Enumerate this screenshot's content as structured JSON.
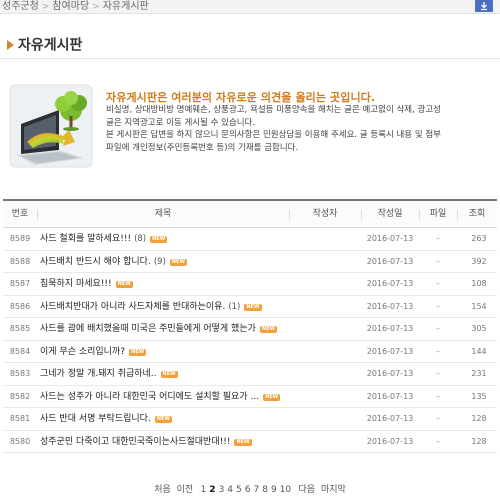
{
  "breadcrumb": {
    "items": [
      "성주군청",
      "참여마당",
      "자유게시판"
    ]
  },
  "page": {
    "title": "자유게시판"
  },
  "intro": {
    "heading": "자유게시판은 여러분의 자유로운 의견을 올리는 곳입니다.",
    "lines": [
      "비실명, 상대방비방 명예훼손, 상품광고, 욕설등 미풍양속을 해치는 글은 예고없이 삭제, 광고성",
      "글은 지역광고로 이동 게시될 수 있습니다.",
      "본 게시판은 답변을 하지 않으니 문의사항은 민원상담을 이용해 주세요. 글 등록시 내용 및 첨부",
      "파일에 개인정보(주민등록번호 등)의 기재를 금합니다."
    ]
  },
  "board": {
    "columns": {
      "num": "번호",
      "title": "제목",
      "author": "작성자",
      "date": "작성일",
      "file": "파일",
      "hits": "조회"
    },
    "new_label": "NEW",
    "rows": [
      {
        "num": "8589",
        "title": "사드 철회를 말하세요!!!",
        "comments": "(8)",
        "author": "",
        "date": "2016-07-13",
        "file": "–",
        "hits": "263"
      },
      {
        "num": "8588",
        "title": "사드배치 반드시 해야 합니다.",
        "comments": "(9)",
        "author": "",
        "date": "2016-07-13",
        "file": "–",
        "hits": "392"
      },
      {
        "num": "8587",
        "title": "침묵하지 마세요!!!",
        "comments": "",
        "author": "",
        "date": "2016-07-13",
        "file": "–",
        "hits": "108"
      },
      {
        "num": "8586",
        "title": "사드배치반대가 아니라 사드자체를 반대하는이유.",
        "comments": "(1)",
        "author": "",
        "date": "2016-07-13",
        "file": "–",
        "hits": "154"
      },
      {
        "num": "8585",
        "title": "사드를 괌에 배치했을때 미국은 주민들에게 어떻게 했는가",
        "comments": "",
        "author": "",
        "date": "2016-07-13",
        "file": "–",
        "hits": "305"
      },
      {
        "num": "8584",
        "title": "이게 무슨 소리입니까?",
        "comments": "",
        "author": "",
        "date": "2016-07-13",
        "file": "–",
        "hits": "144"
      },
      {
        "num": "8583",
        "title": "그네가 정말 개.돼지 취급하네..",
        "comments": "",
        "author": "",
        "date": "2016-07-13",
        "file": "–",
        "hits": "231"
      },
      {
        "num": "8582",
        "title": "사드는 성주가 아니라 대한민국 어디에도 설치할 필요가 ...",
        "comments": "",
        "author": "",
        "date": "2016-07-13",
        "file": "–",
        "hits": "135"
      },
      {
        "num": "8581",
        "title": "사드 반대 서명 부탁드립니다.",
        "comments": "",
        "author": "",
        "date": "2016-07-13",
        "file": "–",
        "hits": "128"
      },
      {
        "num": "8580",
        "title": "성주군민 다죽이고 대한민국죽이는사드절대반대!!!",
        "comments": "",
        "author": "",
        "date": "2016-07-13",
        "file": "–",
        "hits": "128"
      }
    ]
  },
  "pagination": {
    "first": "처음",
    "prev": "이전",
    "pages": [
      "1",
      "2",
      "3",
      "4",
      "5",
      "6",
      "7",
      "8",
      "9",
      "10"
    ],
    "current": "2",
    "next": "다음",
    "last": "마지막"
  },
  "colors": {
    "accent": "#cf7b1d",
    "badge": "#f0a13c",
    "download_button": "#4a6fc0"
  },
  "icons": {
    "download": "download-icon",
    "title_bullet": "triangle-bullet-icon",
    "intro": "laptop-tree-illustration"
  }
}
